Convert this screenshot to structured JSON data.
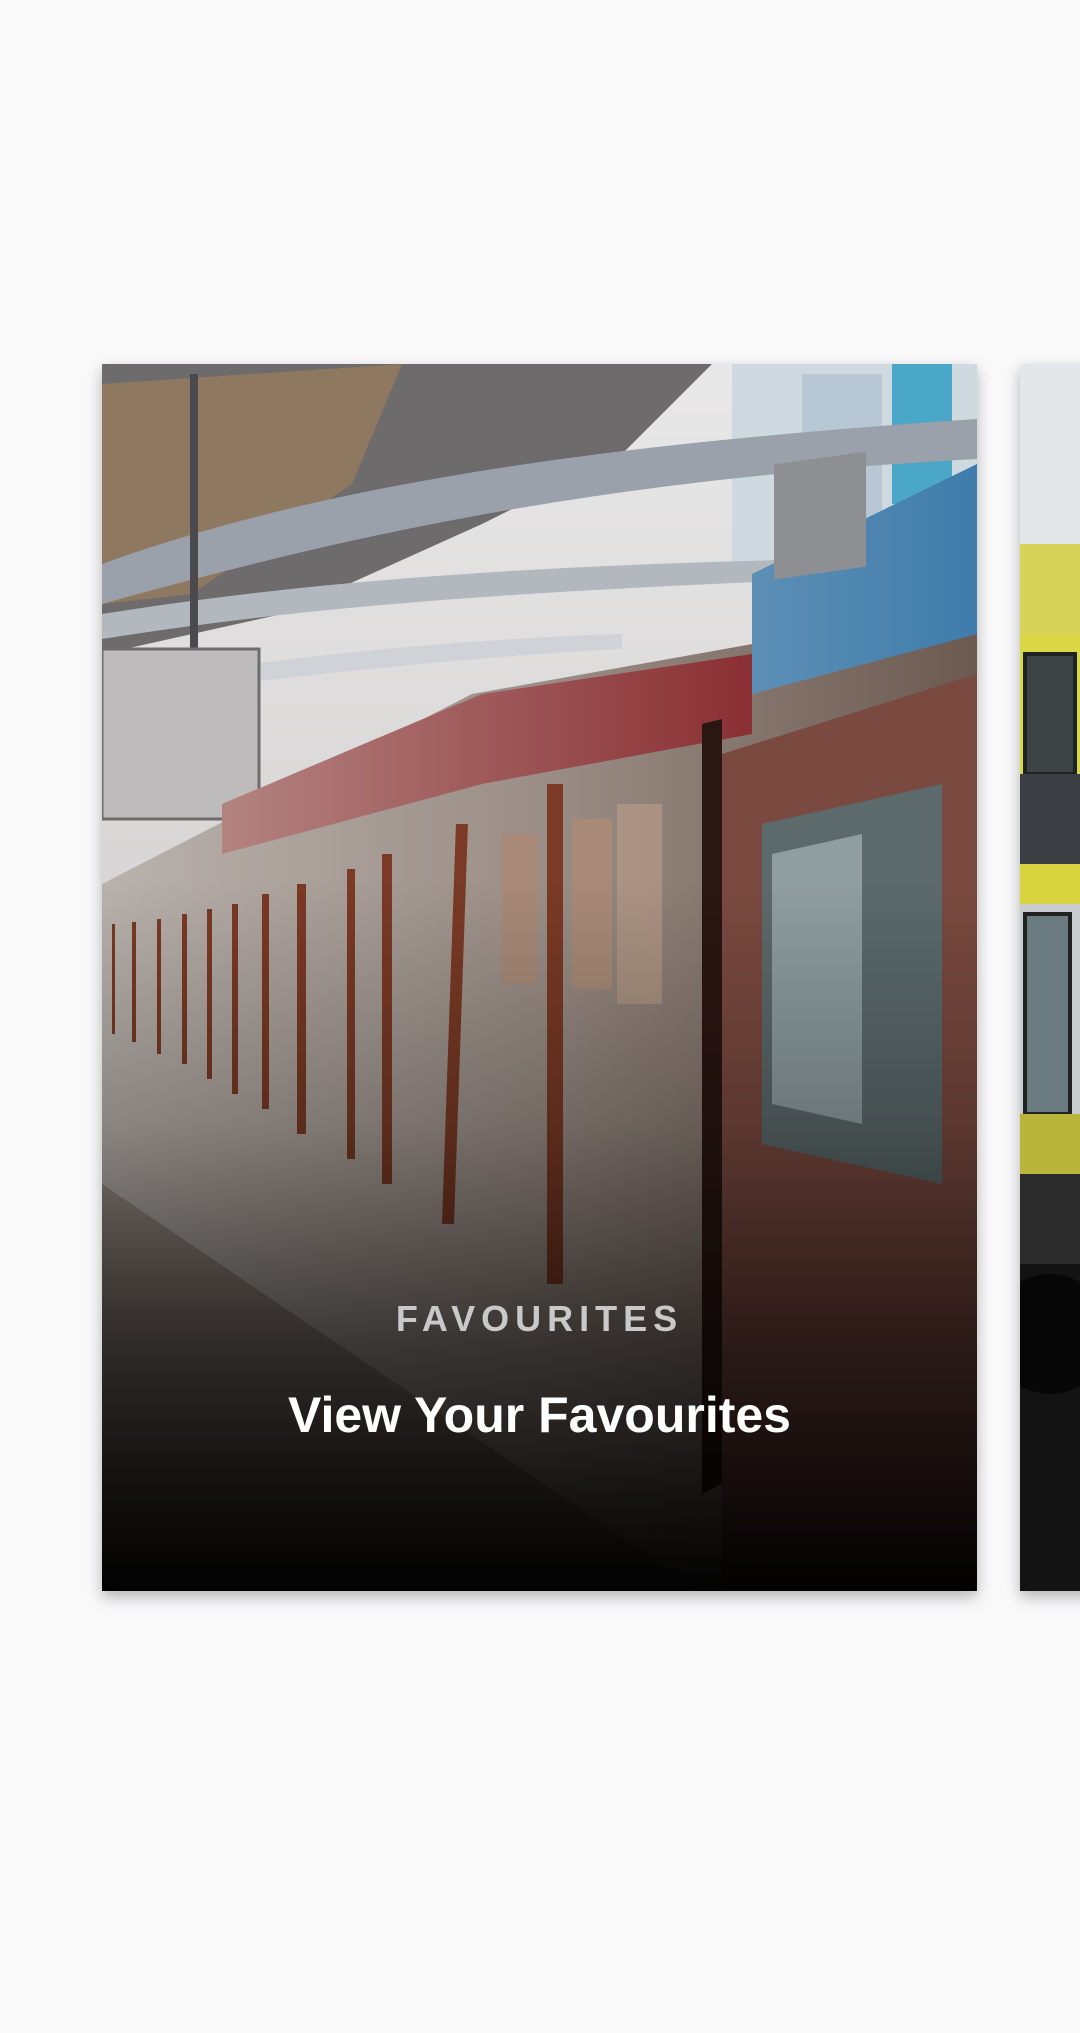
{
  "carousel": {
    "cards": [
      {
        "eyebrow": "FAVOURITES",
        "title": "View Your Favourites",
        "image": "train-platform-photo"
      },
      {
        "eyebrow": "",
        "title": "",
        "image": "yellow-bus-photo"
      }
    ]
  },
  "colors": {
    "background": "#f9f9fa",
    "eyebrow_text": "#c9c9c9",
    "title_text": "#ffffff"
  }
}
